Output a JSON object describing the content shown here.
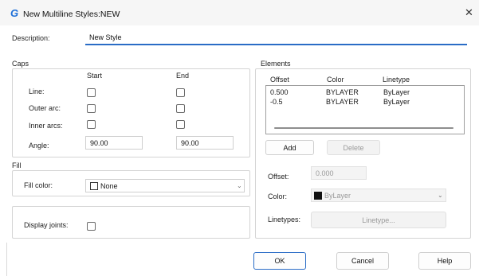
{
  "window": {
    "title": "New Multiline Styles:NEW",
    "close_symbol": "✕",
    "app_icon": "G"
  },
  "description": {
    "label": "Description:",
    "value": "New Style"
  },
  "caps": {
    "group_label": "Caps",
    "col_start": "Start",
    "col_end": "End",
    "rows": [
      {
        "label": "Line:"
      },
      {
        "label": "Outer arc:"
      },
      {
        "label": "Inner arcs:"
      }
    ],
    "angle_label": "Angle:",
    "angle_start": "90.00",
    "angle_end": "90.00"
  },
  "fill": {
    "group_label": "Fill",
    "label": "Fill color:",
    "value": "None"
  },
  "display_joints": {
    "label": "Display joints:"
  },
  "elements": {
    "group_label": "Elements",
    "headers": {
      "offset": "Offset",
      "color": "Color",
      "linetype": "Linetype"
    },
    "rows": [
      {
        "offset": "0.500",
        "color": "BYLAYER",
        "linetype": "ByLayer"
      },
      {
        "offset": "-0.5",
        "color": "BYLAYER",
        "linetype": "ByLayer"
      }
    ],
    "add_label": "Add",
    "delete_label": "Delete",
    "offset_label": "Offset:",
    "offset_value": "0.000",
    "color_label": "Color:",
    "color_value": "ByLayer",
    "linetypes_label": "Linetypes:",
    "linetype_button": "Linetype..."
  },
  "footer": {
    "ok": "OK",
    "cancel": "Cancel",
    "help": "Help"
  },
  "colors": {
    "accent": "#2a6cc6",
    "app_icon": "#1d6fd8"
  }
}
